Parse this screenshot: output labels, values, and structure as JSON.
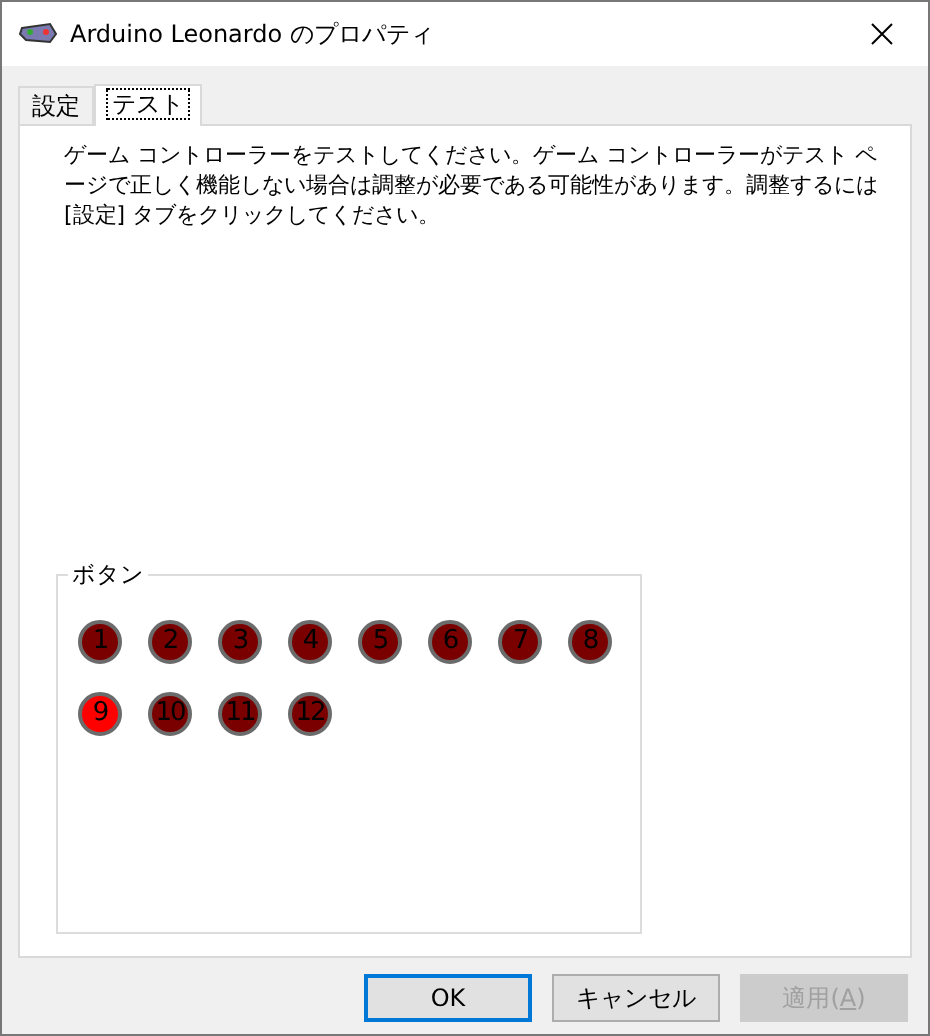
{
  "window": {
    "title": "Arduino Leonardo のプロパティ"
  },
  "tabs": [
    {
      "label": "設定",
      "selected": false
    },
    {
      "label": "テスト",
      "selected": true
    }
  ],
  "description": "ゲーム コントローラーをテストしてください。ゲーム コントローラーがテスト ページで正しく機能しない場合は調整が必要である可能性があります。調整するには [設定] タブをクリックしてください。",
  "button_group": {
    "title": "ボタン",
    "buttons": [
      {
        "label": "1",
        "pressed": false
      },
      {
        "label": "2",
        "pressed": false
      },
      {
        "label": "3",
        "pressed": false
      },
      {
        "label": "4",
        "pressed": false
      },
      {
        "label": "5",
        "pressed": false
      },
      {
        "label": "6",
        "pressed": false
      },
      {
        "label": "7",
        "pressed": false
      },
      {
        "label": "8",
        "pressed": false
      },
      {
        "label": "9",
        "pressed": true
      },
      {
        "label": "10",
        "pressed": false
      },
      {
        "label": "11",
        "pressed": false
      },
      {
        "label": "12",
        "pressed": false
      }
    ]
  },
  "dialog_buttons": [
    {
      "parts": [
        {
          "text": "OK",
          "underline": false
        }
      ],
      "default": true,
      "disabled": false
    },
    {
      "parts": [
        {
          "text": "キャンセル",
          "underline": false
        }
      ],
      "default": false,
      "disabled": false
    },
    {
      "parts": [
        {
          "text": "適用(",
          "underline": false
        },
        {
          "text": "A",
          "underline": true
        },
        {
          "text": ")",
          "underline": false
        }
      ],
      "default": false,
      "disabled": true
    }
  ]
}
